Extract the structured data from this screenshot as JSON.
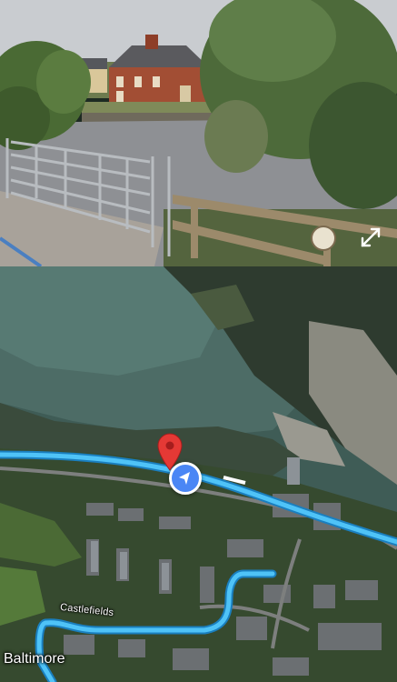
{
  "street_view": {
    "expand_icon": "fullscreen-expand-icon"
  },
  "map": {
    "road_label": "Castlefields",
    "town_label": "Baltimore",
    "pin_icon": "location-pin-icon",
    "position_icon": "navigation-arrow-icon",
    "route_color": "#4fc3f7",
    "pin_color": "#e53935",
    "position_color": "#4a86f5"
  }
}
